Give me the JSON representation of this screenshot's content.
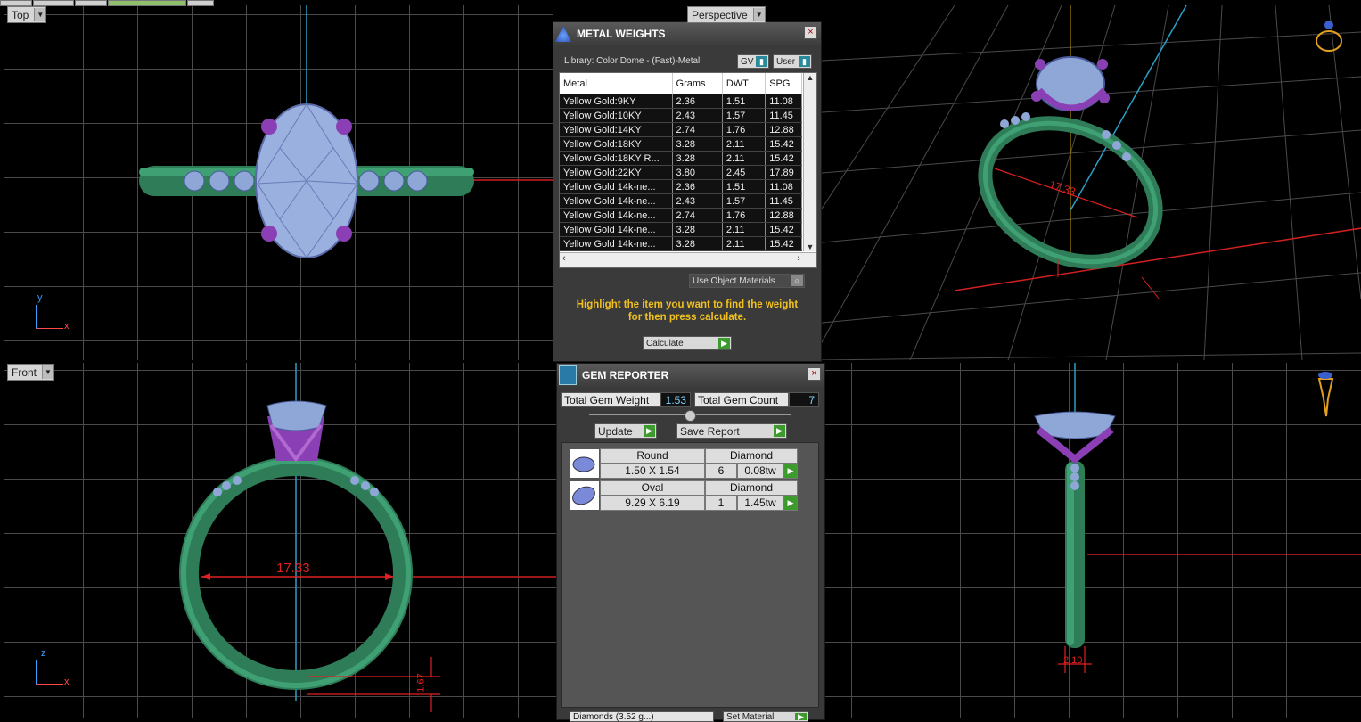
{
  "viewports": {
    "top": {
      "label": "Top"
    },
    "perspective": {
      "label": "Perspective"
    },
    "front": {
      "label": "Front"
    },
    "right_view": {
      "label": ""
    }
  },
  "axes": {
    "top_y": "y",
    "top_x": "x",
    "front_z": "z",
    "front_x": "x"
  },
  "dimensions": {
    "front_inner": "17.33",
    "persp_inner": "17.33",
    "front_bottom": "1.67",
    "right_bottom": "2.10"
  },
  "metal_weights": {
    "title": "METAL WEIGHTS",
    "library": "Library: Color Dome - (Fast)-Metal",
    "toggle_gv": "GV",
    "toggle_user": "User",
    "columns": [
      "Metal",
      "Grams",
      "DWT",
      "SPG"
    ],
    "rows": [
      [
        "Yellow Gold:9KY",
        "2.36",
        "1.51",
        "11.08"
      ],
      [
        "Yellow Gold:10KY",
        "2.43",
        "1.57",
        "11.45"
      ],
      [
        "Yellow Gold:14KY",
        "2.74",
        "1.76",
        "12.88"
      ],
      [
        "Yellow Gold:18KY",
        "3.28",
        "2.11",
        "15.42"
      ],
      [
        "Yellow Gold:18KY R...",
        "3.28",
        "2.11",
        "15.42"
      ],
      [
        "Yellow Gold:22KY",
        "3.80",
        "2.45",
        "17.89"
      ],
      [
        "Yellow Gold 14k-ne...",
        "2.36",
        "1.51",
        "11.08"
      ],
      [
        "Yellow Gold 14k-ne...",
        "2.43",
        "1.57",
        "11.45"
      ],
      [
        "Yellow Gold 14k-ne...",
        "2.74",
        "1.76",
        "12.88"
      ],
      [
        "Yellow Gold 14k-ne...",
        "3.28",
        "2.11",
        "15.42"
      ],
      [
        "Yellow Gold 14k-ne...",
        "3.28",
        "2.11",
        "15.42"
      ]
    ],
    "use_object_materials": "Use Object Materials",
    "hint": "Highlight the item you want to find the weight for then press calculate.",
    "calculate": "Calculate"
  },
  "gem_reporter": {
    "title": "GEM REPORTER",
    "total_weight_label": "Total Gem Weight",
    "total_weight": "1.53",
    "total_count_label": "Total Gem Count",
    "total_count": "7",
    "update": "Update",
    "save_report": "Save Report",
    "gems": [
      {
        "shape": "Round",
        "type": "Diamond",
        "size": "1.50 X 1.54",
        "count": "6",
        "weight": "0.08tw"
      },
      {
        "shape": "Oval",
        "type": "Diamond",
        "size": "9.29 X 6.19",
        "count": "1",
        "weight": "1.45tw"
      }
    ],
    "bottom_select": "Diamonds (3.52 g...)",
    "bottom_button": "Set Material"
  },
  "colors": {
    "band": "#2f8a5f",
    "prong": "#8a3fb5",
    "gem": "#8fa7d6",
    "dim": "#e02020",
    "grid": "#4a4a4a"
  }
}
